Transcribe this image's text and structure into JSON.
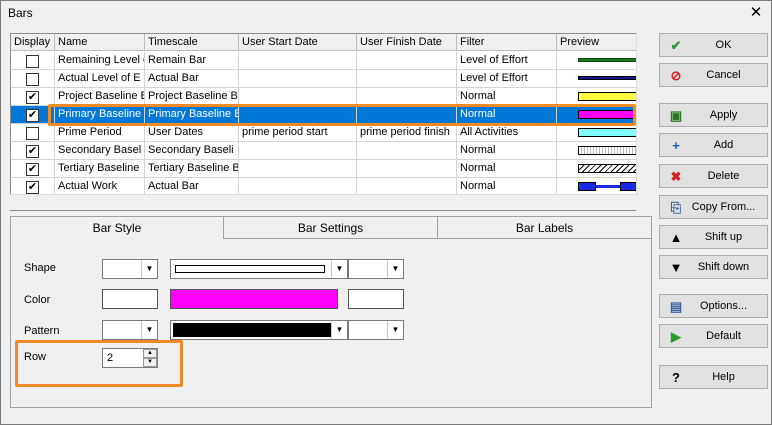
{
  "window": {
    "title": "Bars",
    "close_symbol": "✕"
  },
  "grid": {
    "columns": [
      "Display",
      "Name",
      "Timescale",
      "User Start Date",
      "User Finish Date",
      "Filter",
      "Preview"
    ],
    "rows": [
      {
        "display": false,
        "name": "Remaining Level o",
        "timescale": "Remain Bar",
        "start": "",
        "finish": "",
        "filter": "Level of Effort",
        "preview": "remaining-level",
        "selected": false
      },
      {
        "display": false,
        "name": "Actual Level of E",
        "timescale": "Actual Bar",
        "start": "",
        "finish": "",
        "filter": "Level of Effort",
        "preview": "actual-level",
        "selected": false
      },
      {
        "display": true,
        "name": "Project Baseline B",
        "timescale": "Project Baseline B",
        "start": "",
        "finish": "",
        "filter": "Normal",
        "preview": "project-baseline",
        "selected": false
      },
      {
        "display": true,
        "name": "Primary Baseline",
        "timescale": "Primary Baseline B",
        "start": "",
        "finish": "",
        "filter": "Normal",
        "preview": "primary-baseline",
        "selected": true
      },
      {
        "display": false,
        "name": "Prime Period",
        "timescale": "User Dates",
        "start": "prime period start",
        "finish": "prime period finish",
        "filter": "All Activities",
        "preview": "prime-period",
        "selected": false
      },
      {
        "display": true,
        "name": "Secondary Basel",
        "timescale": "Secondary Baseli",
        "start": "",
        "finish": "",
        "filter": "Normal",
        "preview": "secondary-baseline",
        "selected": false
      },
      {
        "display": true,
        "name": "Tertiary Baseline",
        "timescale": "Tertiary Baseline B",
        "start": "",
        "finish": "",
        "filter": "Normal",
        "preview": "tertiary-baseline",
        "selected": false
      },
      {
        "display": true,
        "name": "Actual Work",
        "timescale": "Actual Bar",
        "start": "",
        "finish": "",
        "filter": "Normal",
        "preview": "actual-work",
        "selected": false
      }
    ],
    "check_symbol": "✔"
  },
  "tabs": [
    "Bar Style",
    "Bar Settings",
    "Bar Labels"
  ],
  "bar_style": {
    "shape_label": "Shape",
    "color_label": "Color",
    "pattern_label": "Pattern",
    "row_label": "Row",
    "row_value": "2",
    "middle_color": "#ff00ff",
    "pattern_color": "#000000"
  },
  "buttons": [
    {
      "label": "OK",
      "icon": "check-icon",
      "glyph": "✔",
      "color": "#2c9a2c"
    },
    {
      "label": "Cancel",
      "icon": "cancel-icon",
      "glyph": "⊘",
      "color": "#d42020"
    },
    {
      "label": "Apply",
      "icon": "apply-icon",
      "glyph": "▣",
      "color": "#2a7a2a"
    },
    {
      "label": "Add",
      "icon": "plus-icon",
      "glyph": "+",
      "color": "#1a5fc8"
    },
    {
      "label": "Delete",
      "icon": "delete-icon",
      "glyph": "✖",
      "color": "#d42020"
    },
    {
      "label": "Copy From...",
      "icon": "copy-icon",
      "glyph": "⎘",
      "color": "#3a5fa0"
    },
    {
      "label": "Shift up",
      "icon": "arrow-up-icon",
      "glyph": "▲",
      "color": "#000000"
    },
    {
      "label": "Shift down",
      "icon": "arrow-down-icon",
      "glyph": "▼",
      "color": "#000000"
    },
    {
      "label": "Options...",
      "icon": "options-icon",
      "glyph": "▤",
      "color": "#3a5fa0"
    },
    {
      "label": "Default",
      "icon": "play-icon",
      "glyph": "▶",
      "color": "#2c9a2c"
    },
    {
      "label": "Help",
      "icon": "help-icon",
      "glyph": "?",
      "color": "#000000"
    }
  ],
  "colors": {
    "selection": "#0078d7",
    "highlight": "#f08a24"
  }
}
